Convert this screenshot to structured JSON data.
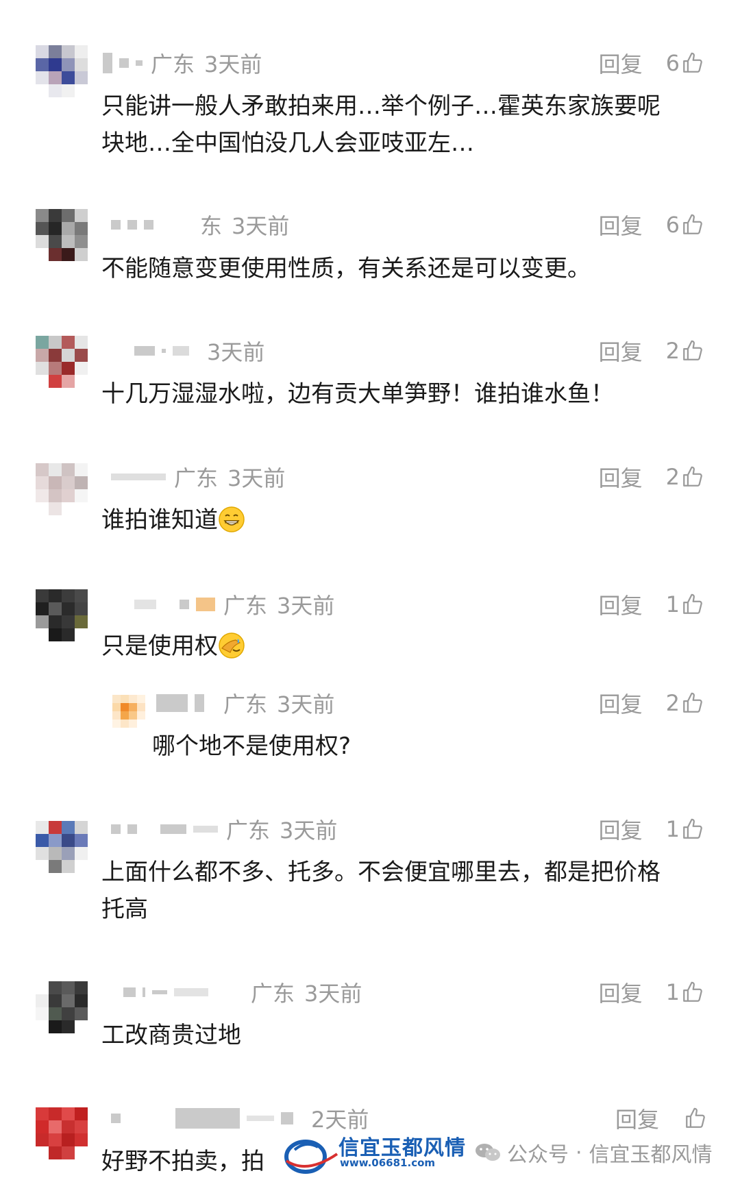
{
  "reply_label": "回复",
  "comments": [
    {
      "location": "广东",
      "time": "3天前",
      "likes": "6",
      "text_lines": [
        "只能讲一般人矛敢拍来用…举个例子…霍英东家族要呢",
        "块地…全中国怕没几人会亚吱亚左…"
      ]
    },
    {
      "location": "东",
      "time": "3天前",
      "likes": "6",
      "text_lines": [
        "不能随意变更使用性质，有关系还是可以变更。"
      ]
    },
    {
      "location": "",
      "time": "3天前",
      "likes": "2",
      "text_lines": [
        "十几万湿湿水啦，边有贡大单笋野！谁拍谁水鱼！"
      ]
    },
    {
      "location": "广东",
      "time": "3天前",
      "likes": "2",
      "text_lines": [
        "谁拍谁知道"
      ],
      "emoji": "grinning-face-emoji"
    },
    {
      "location": "广东",
      "time": "3天前",
      "likes": "1",
      "text_lines": [
        "只是使用权"
      ],
      "emoji": "face-palm-emoji"
    },
    {
      "location": "广东",
      "time": "3天前",
      "likes": "2",
      "text_lines": [
        "哪个地不是使用权?"
      ],
      "is_reply": true
    },
    {
      "location": "广东",
      "time": "3天前",
      "likes": "1",
      "text_lines": [
        "上面什么都不多、托多。不会便宜哪里去，都是把价格",
        "托高"
      ]
    },
    {
      "location": "广东",
      "time": "3天前",
      "likes": "1",
      "text_lines": [
        "工改商贵过地"
      ]
    },
    {
      "location": "",
      "time": "2天前",
      "likes": "",
      "text_lines": [
        "好野不拍卖，拍"
      ]
    }
  ],
  "watermark": {
    "logo_text": "信宜玉都风情",
    "url": "www.06681.com",
    "account_label": "公众号",
    "account_separator": "·",
    "account_name": "信宜玉都风情"
  },
  "colors": {
    "meta_gray": "#9a9a9a",
    "text_black": "#1a1a1a",
    "watermark_blue": "#1a5fb4"
  }
}
